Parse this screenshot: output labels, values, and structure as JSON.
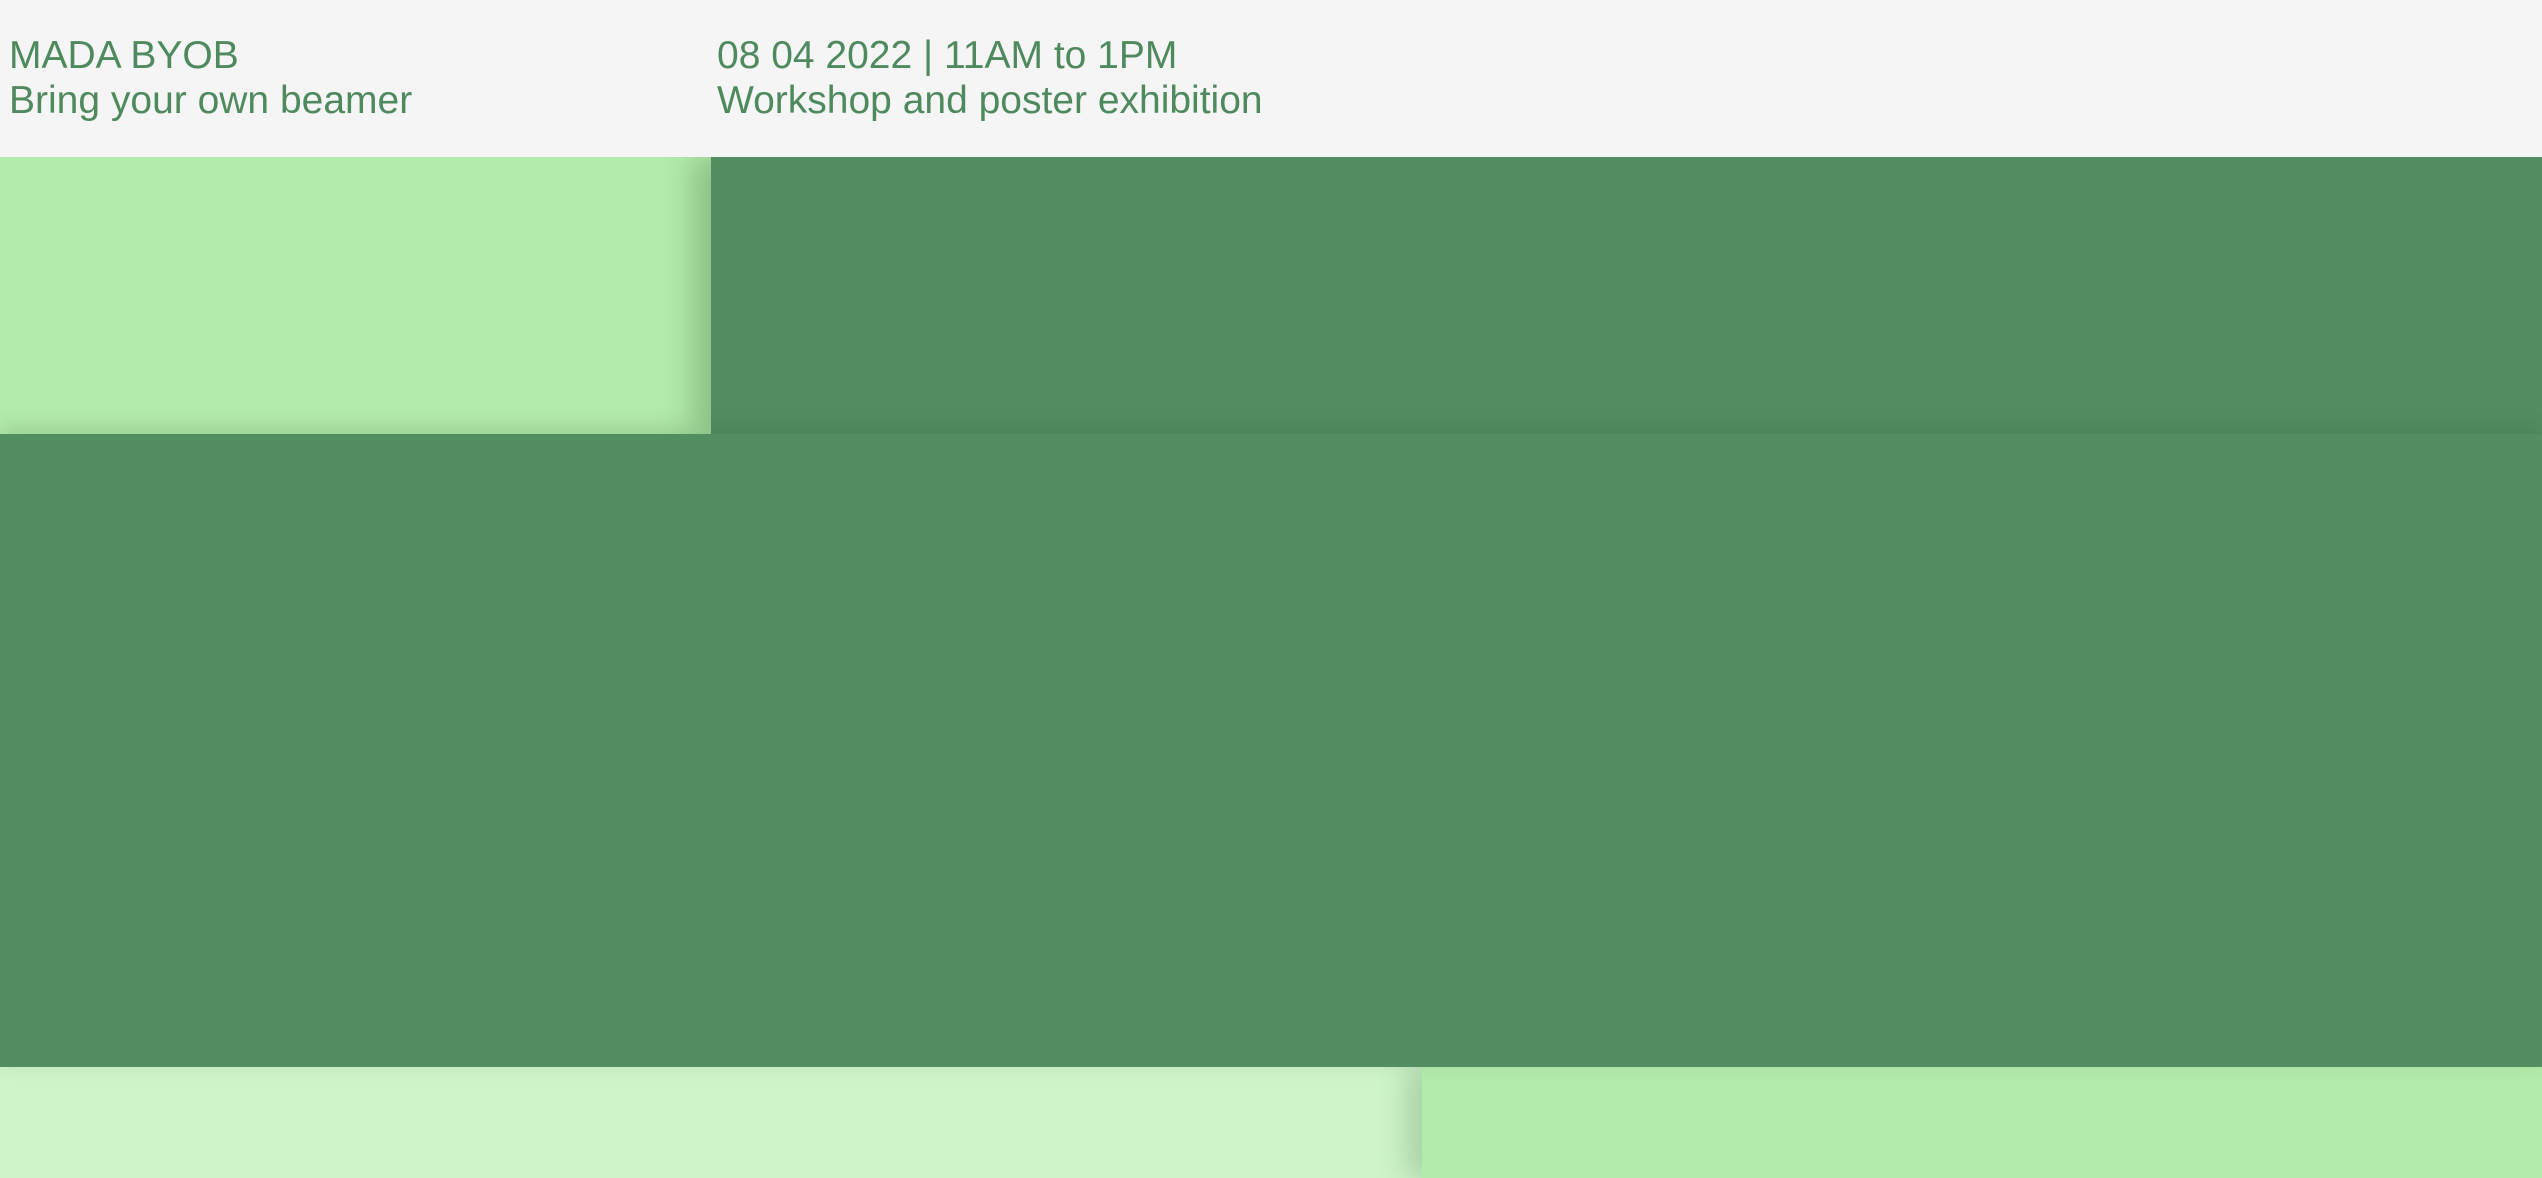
{
  "header": {
    "event_name": "MADA BYOB",
    "event_subtitle": "Bring your own beamer",
    "date_time": "08 04 2022 | 11AM to 1PM",
    "event_type": "Workshop and poster exhibition"
  },
  "colors": {
    "text": "#4e8a5d",
    "background": "#f5f5f5",
    "dark_green": "#528e62",
    "light_green": "#b2ecaa",
    "pale_green": "#cff4ca"
  }
}
